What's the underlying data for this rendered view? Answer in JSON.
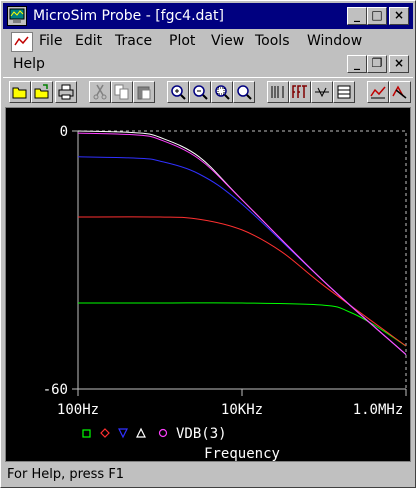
{
  "window": {
    "title": "MicroSim Probe - [fgc4.dat]",
    "controls": {
      "minimize": "_",
      "maximize": "□",
      "close": "×"
    }
  },
  "menu": {
    "items": [
      "File",
      "Edit",
      "Trace",
      "Plot",
      "View",
      "Tools",
      "Window",
      "Help"
    ],
    "doc_controls": {
      "minimize": "_",
      "restore": "❐",
      "close": "×"
    }
  },
  "toolbar": {
    "buttons": [
      "open-icon",
      "open-folder-icon",
      "print-icon",
      "cut-icon",
      "copy-icon",
      "paste-icon",
      "zoom-in-icon",
      "zoom-out-icon",
      "zoom-area-icon",
      "zoom-fit-icon",
      "log-axis-icon",
      "fft-icon",
      "performance-icon",
      "bode-icon",
      "cursor-icon",
      "cursor-peak-icon"
    ]
  },
  "plot": {
    "y_top_label": "0",
    "y_bottom_label": "-60",
    "x_labels": [
      "100Hz",
      "10KHz",
      "1.0MHz"
    ],
    "legend_trace": "VDB(3)",
    "xlabel": "Frequency",
    "colors": {
      "background": "#000000",
      "grid": "#c0c0c0",
      "axis_text": "#ffffff",
      "trace1": "#00ff00",
      "trace2": "#ff3030",
      "trace3": "#3030ff",
      "trace4": "#ffffff",
      "trace5": "#ff40ff"
    }
  },
  "chart_data": {
    "type": "line",
    "xlabel": "Frequency",
    "ylabel": "",
    "x_scale": "log",
    "xlim": [
      100,
      1000000
    ],
    "ylim": [
      -60,
      0
    ],
    "x_ticks": [
      "100Hz",
      "10KHz",
      "1.0MHz"
    ],
    "y_ticks": [
      "0",
      "-60"
    ],
    "legend_label": "VDB(3)",
    "series": [
      {
        "marker": "square",
        "color": "#00ff00",
        "x": [
          100,
          1000,
          10000,
          100000,
          200000,
          400000,
          1000000
        ],
        "y": [
          -40,
          -40,
          -40,
          -40.5,
          -42,
          -45,
          -50
        ]
      },
      {
        "marker": "diamond",
        "color": "#ff3030",
        "x": [
          100,
          1000,
          3000,
          10000,
          30000,
          100000,
          1000000
        ],
        "y": [
          -20,
          -20,
          -20.5,
          -23,
          -28,
          -36,
          -50
        ]
      },
      {
        "marker": "triangle-down",
        "color": "#3030ff",
        "x": [
          100,
          500,
          1000,
          3000,
          10000,
          100000,
          1000000
        ],
        "y": [
          -6,
          -6.3,
          -7,
          -10,
          -17,
          -35,
          -52
        ]
      },
      {
        "marker": "triangle-up",
        "color": "#ffffff",
        "x": [
          100,
          500,
          1000,
          3000,
          10000,
          100000,
          1000000
        ],
        "y": [
          0,
          -0.4,
          -1.5,
          -6,
          -16,
          -35,
          -52
        ]
      },
      {
        "marker": "circle",
        "color": "#ff40ff",
        "x": [
          100,
          500,
          1000,
          3000,
          10000,
          100000,
          1000000
        ],
        "y": [
          -0.5,
          -0.9,
          -2,
          -6.5,
          -16,
          -35,
          -52
        ]
      }
    ]
  },
  "status": {
    "text": "For Help, press F1"
  }
}
